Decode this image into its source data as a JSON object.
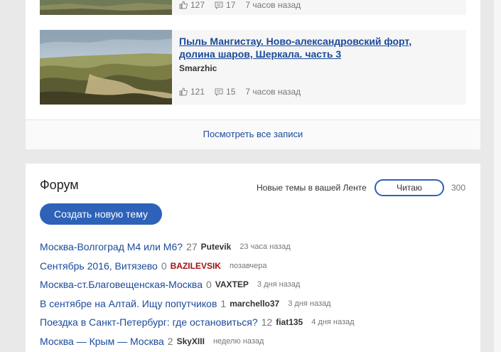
{
  "blog": {
    "entries": [
      {
        "likes": "127",
        "comments": "17",
        "time": "7 часов назад"
      },
      {
        "title": "Пыль Мангистау. Ново-александровский форт, долина шаров, Шеркала. часть 3",
        "author": "Smarzhic",
        "likes": "121",
        "comments": "15",
        "time": "7 часов назад"
      }
    ],
    "view_all_label": "Посмотреть все записи"
  },
  "forum": {
    "title": "Форум",
    "subscribe_label": "Новые темы в вашей Ленте",
    "read_button_label": "Читаю",
    "subscribers_count": "300",
    "create_button_label": "Создать новую тему",
    "topics": [
      {
        "title": "Москва-Волгоград М4 или М6?",
        "count": "27",
        "author": "Putevik",
        "time": "23 часа назад",
        "author_color": "#333333"
      },
      {
        "title": "Сентябрь 2016, Витязево",
        "count": "0",
        "author": "BAZILEVSIK",
        "time": "позавчера",
        "author_color": "#a01313"
      },
      {
        "title": "Москва-ст.Благовещенская-Москва",
        "count": "0",
        "author": "VAXTEP",
        "time": "3 дня назад",
        "author_color": "#333333"
      },
      {
        "title": "В сентябре на Алтай. Ищу попутчиков",
        "count": "1",
        "author": "marchello37",
        "time": "3 дня назад",
        "author_color": "#333333"
      },
      {
        "title": "Поездка в Санкт-Петербург: где остановиться?",
        "count": "12",
        "author": "fiat135",
        "time": "4 дня назад",
        "author_color": "#333333"
      },
      {
        "title": "Москва — Крым — Москва",
        "count": "2",
        "author": "SkyXIII",
        "time": "неделю назад",
        "author_color": "#333333"
      }
    ]
  },
  "colors": {
    "link": "#1a4a9a",
    "accent": "#2d62b8",
    "author_highlight": "#a01313"
  }
}
